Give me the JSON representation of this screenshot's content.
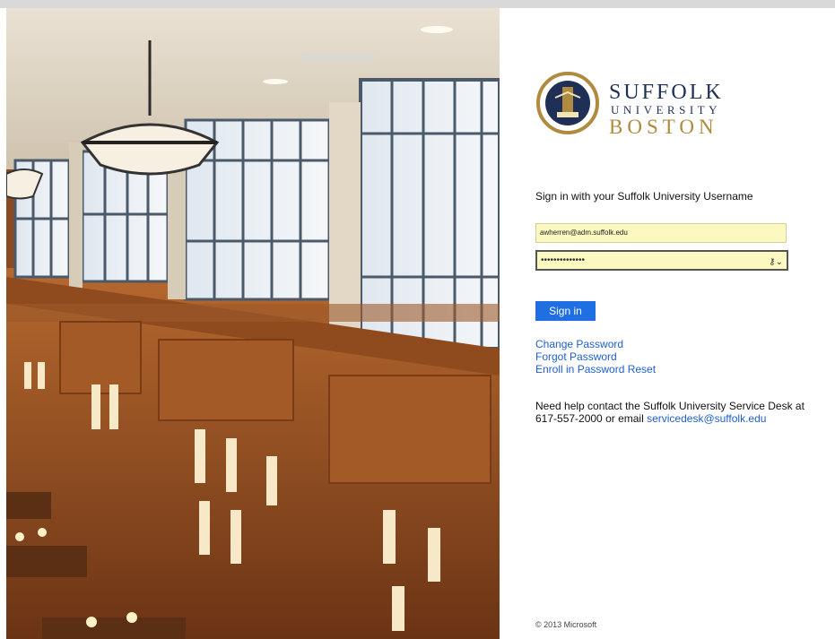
{
  "brand": {
    "line1": "SUFFOLK",
    "line2": "UNIVERSITY",
    "line3": "BOSTON",
    "primary_color": "#1f2f56",
    "accent_color": "#b08a3e"
  },
  "form": {
    "heading": "Sign in with your Suffolk University Username",
    "email_value": "awherren@adm.suffolk.edu",
    "password_masked": "••••••••••••••",
    "sign_in_label": "Sign in"
  },
  "links": {
    "change_password": "Change Password",
    "forgot_password": "Forgot Password",
    "enroll_reset": "Enroll in Password Reset"
  },
  "help": {
    "text": "Need help contact the Suffolk University Service Desk at 617-557-2000 or email",
    "email": "servicedesk@suffolk.edu"
  },
  "footer": {
    "copyright": "© 2013 Microsoft"
  },
  "icons": {
    "password_manager": "key-icon"
  }
}
